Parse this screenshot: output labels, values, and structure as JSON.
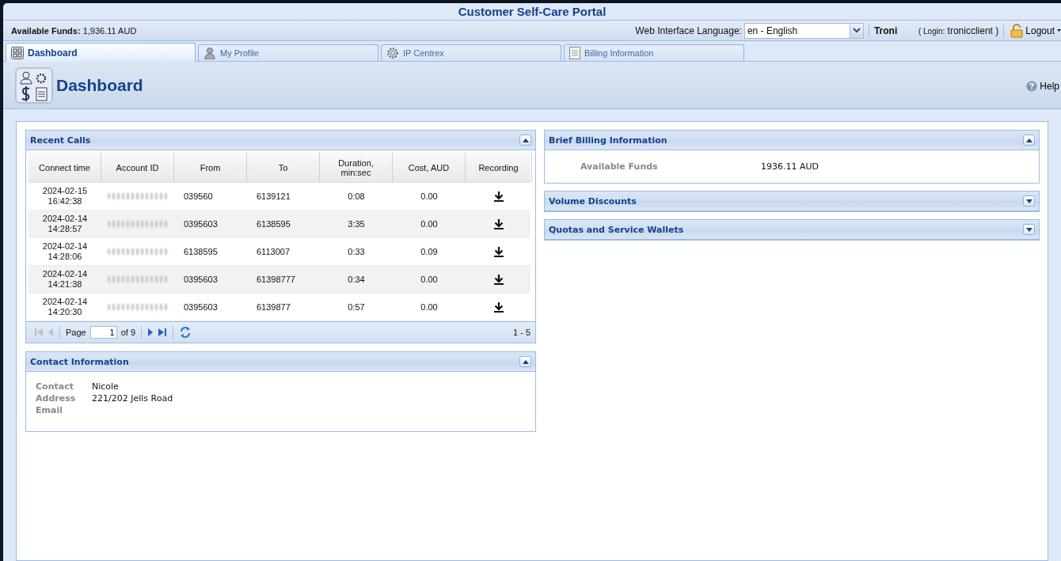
{
  "window": {
    "title": "Customer Self-Care Portal"
  },
  "top_bar": {
    "funds_label": "Available Funds:",
    "funds_value": "1,936.11 AUD",
    "language_label": "Web Interface Language:",
    "language_value": "en - English",
    "user": "Troni",
    "login_prefix": "( Login:",
    "login_name": "tronicclient",
    "login_suffix": ")",
    "logout": "Logout"
  },
  "tabs": [
    {
      "label": "Dashboard",
      "selected": true
    },
    {
      "label": "My Profile",
      "selected": false
    },
    {
      "label": "IP Centrex",
      "selected": false
    },
    {
      "label": "Billing Information",
      "selected": false
    }
  ],
  "page": {
    "title": "Dashboard",
    "help": "Help"
  },
  "recent_calls": {
    "title": "Recent Calls",
    "expanded": true,
    "columns": [
      "Connect time",
      "Account ID",
      "From",
      "To",
      "Duration, min:sec",
      "Cost, AUD",
      "Recording"
    ],
    "rows": [
      {
        "date": "2024-02-15",
        "time": "16:42:38",
        "from": "039560",
        "to": "6139121",
        "duration": "0:08",
        "cost": "0.00"
      },
      {
        "date": "2024-02-14",
        "time": "14:28:57",
        "from": "0395603",
        "to": "6138595",
        "duration": "3:35",
        "cost": "0.00"
      },
      {
        "date": "2024-02-14",
        "time": "14:28:06",
        "from": "6138595",
        "to": "6113007",
        "duration": "0:33",
        "cost": "0.09"
      },
      {
        "date": "2024-02-14",
        "time": "14:21:38",
        "from": "0395603",
        "to": "61398777",
        "duration": "0:34",
        "cost": "0.00"
      },
      {
        "date": "2024-02-14",
        "time": "14:20:30",
        "from": "0395603",
        "to": "6139877",
        "duration": "0:57",
        "cost": "0.00"
      }
    ],
    "pager": {
      "page_label": "Page",
      "page": "1",
      "of": "of 9",
      "range": "1 - 5"
    }
  },
  "contact": {
    "title": "Contact Information",
    "expanded": true,
    "fields": [
      {
        "label": "Contact",
        "value": "Nicole"
      },
      {
        "label": "Address",
        "value": "221/202 Jells Road"
      },
      {
        "label": "Email"
      }
    ]
  },
  "billing_panels": [
    {
      "title": "Brief Billing Information",
      "expanded": true,
      "fields": [
        {
          "label": "Available Funds",
          "value": "1936.11 AUD"
        }
      ]
    },
    {
      "title": "Volume Discounts",
      "expanded": false
    },
    {
      "title": "Quotas and Service Wallets",
      "expanded": false
    }
  ]
}
